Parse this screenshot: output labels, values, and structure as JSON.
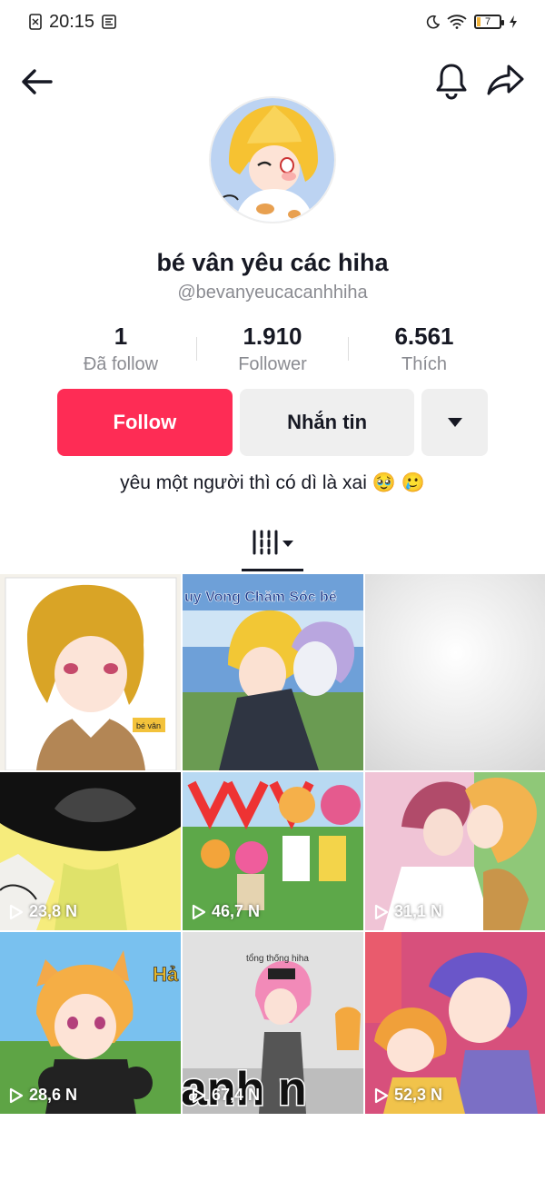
{
  "status_bar": {
    "time": "20:15",
    "battery": "7",
    "icons": [
      "sim-icon",
      "notification-icon",
      "moon-icon",
      "wifi-icon",
      "battery-icon",
      "charging-icon"
    ]
  },
  "nav": {
    "icons": [
      "back-arrow-icon",
      "bell-icon",
      "share-icon"
    ]
  },
  "profile": {
    "name": "bé vân yêu các hiha",
    "handle": "@bevanyeucacanhhiha",
    "bio": "yêu một người thì có dì là xai 🥹 🥲"
  },
  "stats": [
    {
      "value": "1",
      "label": "Đã follow"
    },
    {
      "value": "1.910",
      "label": "Follower"
    },
    {
      "value": "6.561",
      "label": "Thích"
    }
  ],
  "actions": {
    "follow_label": "Follow",
    "message_label": "Nhắn tin"
  },
  "colors": {
    "accent": "#fe2c55",
    "secondary_button": "#efefef",
    "muted_text": "#8a8b91"
  },
  "videos": [
    {
      "views": "",
      "caption": "bé vân"
    },
    {
      "views": "",
      "caption": "uy Vong Chăm Sóc bé"
    },
    {
      "views": "",
      "caption": ""
    },
    {
      "views": "23,8 N",
      "caption": ""
    },
    {
      "views": "46,7 N",
      "caption": ""
    },
    {
      "views": "31,1 N",
      "caption": ""
    },
    {
      "views": "28,6 N",
      "caption": ""
    },
    {
      "views": "67,4 N",
      "caption": "tổng thống hiha"
    },
    {
      "views": "52,3 N",
      "caption": ""
    }
  ]
}
